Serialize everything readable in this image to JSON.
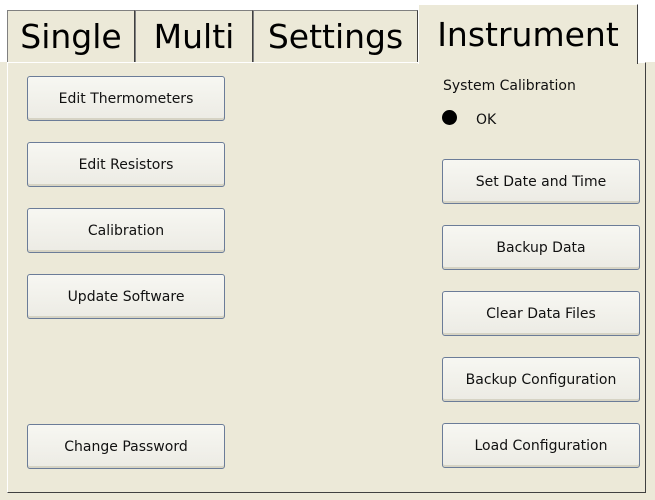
{
  "tabs": [
    {
      "label": "Single",
      "active": false
    },
    {
      "label": "Multi",
      "active": false
    },
    {
      "label": "Settings",
      "active": false
    },
    {
      "label": "Instrument",
      "active": true
    }
  ],
  "left_buttons": {
    "edit_thermometers": "Edit Thermometers",
    "edit_resistors": "Edit Resistors",
    "calibration": "Calibration",
    "update_software": "Update Software",
    "change_password": "Change Password"
  },
  "status": {
    "title": "System Calibration",
    "value": "OK",
    "indicator_color": "#000000"
  },
  "right_buttons": {
    "set_date_time": "Set Date and Time",
    "backup_data": "Backup Data",
    "clear_data_files": "Clear Data Files",
    "backup_configuration": "Backup Configuration",
    "load_configuration": "Load Configuration"
  }
}
